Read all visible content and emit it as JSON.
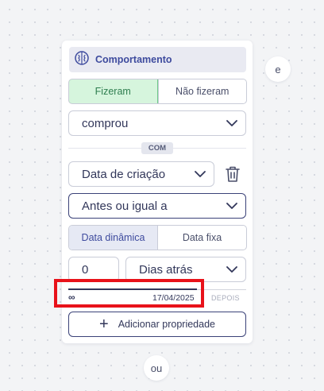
{
  "bubbles": {
    "and_label": "e",
    "or_label": "ou"
  },
  "header": {
    "icon": "brain-icon",
    "title": "Comportamento"
  },
  "performed_toggle": {
    "options": [
      "Fizeram",
      "Não fizeram"
    ],
    "selected": "Fizeram"
  },
  "event_select": {
    "value": "comprou"
  },
  "connector": {
    "label": "COM"
  },
  "property_select": {
    "value": "Data de criação"
  },
  "operator_select": {
    "value": "Antes ou igual a"
  },
  "date_mode_toggle": {
    "options": [
      "Data dinâmica",
      "Data fixa"
    ],
    "selected": "Data dinâmica"
  },
  "amount_input": {
    "value": "0"
  },
  "unit_select": {
    "value": "Dias atrás"
  },
  "range_preview": {
    "start_label": "∞",
    "end_date": "17/04/2025",
    "after_label": "DEPOIS"
  },
  "add_property_button": {
    "label": "Adicionar propriedade"
  },
  "colors": {
    "accent": "#3e4b9e",
    "active_green": "#d6f5dd",
    "highlight_red": "#e8121a"
  }
}
